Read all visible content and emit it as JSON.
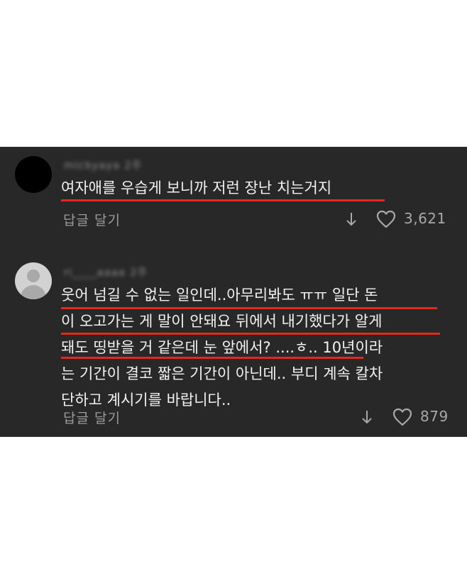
{
  "comments": [
    {
      "username": "mickyaya 2주",
      "lines": [
        "여자애를 우습게 보니까 저런 장난 치는거지"
      ],
      "reply_label": "답글 달기",
      "likes": "3,621"
    },
    {
      "username": "ri____aaaa 2주",
      "lines": [
        "웃어 넘길 수 없는 일인데..아무리봐도 ㅠㅠ 일단 돈",
        "이 오고가는 게 말이 안돼요 뒤에서 내기했다가 알게",
        "돼도 띵받을 거 같은데 눈 앞에서? ....ㅎ.. 10년이라",
        "는 기간이 결코 짧은 기간이 아닌데.. 부디 계속 칼차",
        "단하고 계시기를 바랍니다.."
      ],
      "reply_label": "답글 달기",
      "likes": "879"
    }
  ],
  "colors": {
    "panel_bg": "#282828",
    "text": "#f2f2f2",
    "muted": "#9a9a9a",
    "underline": "#e3281e"
  }
}
